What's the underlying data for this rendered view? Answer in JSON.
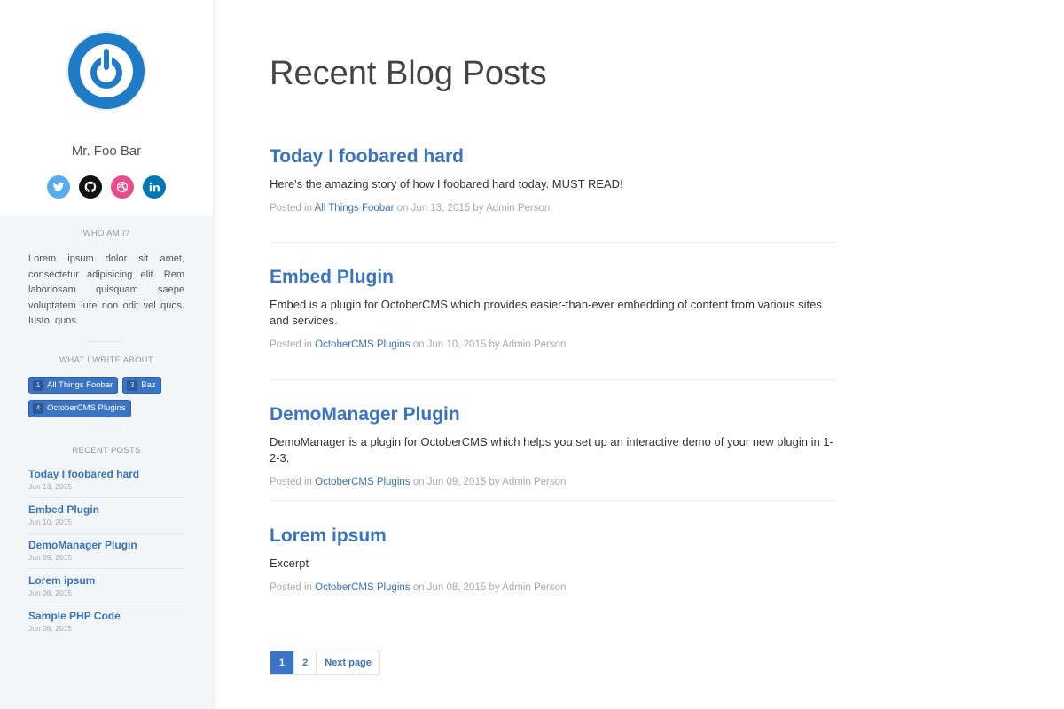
{
  "main": {
    "title": "Recent Blog Posts",
    "meta_prefix": "Posted in",
    "meta_on": "on",
    "meta_by": "by",
    "posts": [
      {
        "title": "Today I foobared hard",
        "excerpt": "Here's the amazing story of how I foobared hard today. MUST READ!",
        "category": "All Things Foobar",
        "date": "Jun 13, 2015",
        "author": "Admin Person"
      },
      {
        "title": "Embed Plugin",
        "excerpt": "Embed is a plugin for OctoberCMS which provides easier-than-ever embedding of content from various sites and services.",
        "category": "OctoberCMS Plugins",
        "date": "Jun 10, 2015",
        "author": "Admin Person"
      },
      {
        "title": "DemoManager Plugin",
        "excerpt": "DemoManager is a plugin for OctoberCMS which helps you set up an interactive demo of your new plugin in 1-2-3.",
        "category": "OctoberCMS Plugins",
        "date": "Jun 09, 2015",
        "author": "Admin Person"
      },
      {
        "title": "Lorem ipsum",
        "excerpt": "Excerpt",
        "category": "OctoberCMS Plugins",
        "date": "Jun 08, 2015",
        "author": "Admin Person"
      }
    ],
    "pagination": {
      "pages": [
        "1",
        "2"
      ],
      "current": "1",
      "next_label": "Next page"
    }
  },
  "sidebar": {
    "author_name": "Mr. Foo Bar",
    "social": [
      {
        "name": "twitter-icon",
        "color": "#55acee"
      },
      {
        "name": "github-icon",
        "color": "#111111"
      },
      {
        "name": "dribbble-icon",
        "color": "#ea4c89"
      },
      {
        "name": "linkedin-icon",
        "color": "#0077b5"
      }
    ],
    "about": {
      "heading": "WHO AM I?",
      "text": "Lorem ipsum dolor sit amet, consectetur adipisicing elit. Rem laboriosam quisquam saepe voluptatem iure non odit vel quos. Iusto, quos."
    },
    "categories": {
      "heading": "WHAT I WRITE ABOUT",
      "items": [
        {
          "count": "1",
          "label": "All Things Foobar"
        },
        {
          "count": "3",
          "label": "Baz"
        },
        {
          "count": "4",
          "label": "OctoberCMS Plugins"
        }
      ]
    },
    "recent": {
      "heading": "RECENT POSTS",
      "items": [
        {
          "title": "Today I foobared hard",
          "date": "Jun 13, 2015"
        },
        {
          "title": "Embed Plugin",
          "date": "Jun 10, 2015"
        },
        {
          "title": "DemoManager Plugin",
          "date": "Jun 09, 2015"
        },
        {
          "title": "Lorem ipsum",
          "date": "Jun 08, 2015"
        },
        {
          "title": "Sample PHP Code",
          "date": "Jun 08, 2015"
        }
      ]
    }
  },
  "colors": {
    "accent": "#3a73c0",
    "tag_bg": "#3b74c4",
    "avatar_blue": "#1f7bc6"
  }
}
